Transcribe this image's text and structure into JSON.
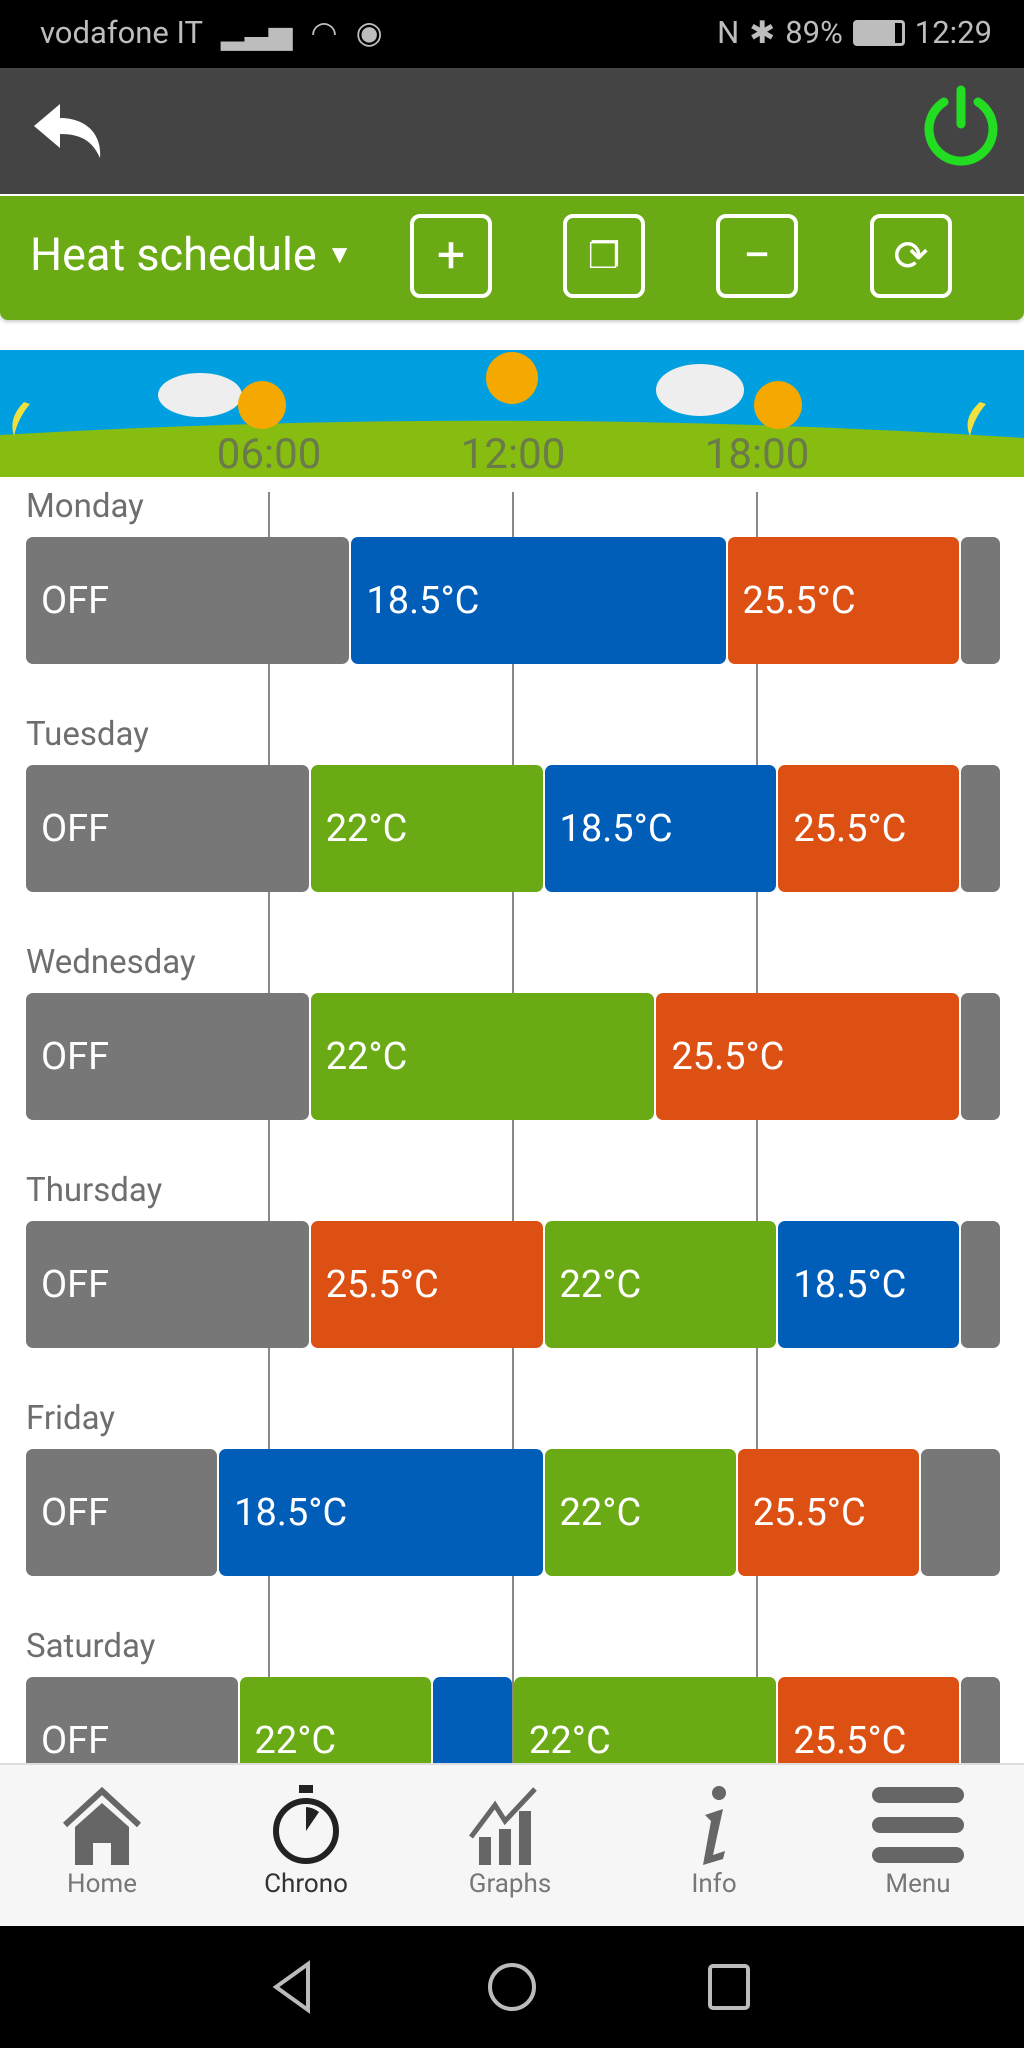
{
  "status_bar": {
    "carrier": "vodafone IT",
    "battery": "89%",
    "time": "12:29"
  },
  "toolbar": {
    "title": "Heat schedule",
    "buttons": [
      "add",
      "copy",
      "remove",
      "sync"
    ]
  },
  "timeline": {
    "ticks": [
      "06:00",
      "12:00",
      "18:00"
    ],
    "tick_hours": [
      6,
      12,
      18
    ]
  },
  "colors": {
    "off": "#777777",
    "18.5°C": "#005eb8",
    "22°C": "#6aaa15",
    "25.5°C": "#dd5014",
    "header": "#444444",
    "toolbar": "#6aaa14",
    "power": "#22dd22"
  },
  "schedule": [
    {
      "day": "Monday",
      "segments": [
        {
          "label": "OFF",
          "start": 0,
          "end": 8
        },
        {
          "label": "18.5°C",
          "start": 8,
          "end": 17.25
        },
        {
          "label": "25.5°C",
          "start": 17.25,
          "end": 23
        },
        {
          "label": "",
          "start": 23,
          "end": 24
        }
      ]
    },
    {
      "day": "Tuesday",
      "segments": [
        {
          "label": "OFF",
          "start": 0,
          "end": 7
        },
        {
          "label": "22°C",
          "start": 7,
          "end": 12.75
        },
        {
          "label": "18.5°C",
          "start": 12.75,
          "end": 18.5
        },
        {
          "label": "25.5°C",
          "start": 18.5,
          "end": 23
        },
        {
          "label": "",
          "start": 23,
          "end": 24
        }
      ]
    },
    {
      "day": "Wednesday",
      "segments": [
        {
          "label": "OFF",
          "start": 0,
          "end": 7
        },
        {
          "label": "22°C",
          "start": 7,
          "end": 15.5
        },
        {
          "label": "25.5°C",
          "start": 15.5,
          "end": 23
        },
        {
          "label": "",
          "start": 23,
          "end": 24
        }
      ]
    },
    {
      "day": "Thursday",
      "segments": [
        {
          "label": "OFF",
          "start": 0,
          "end": 7
        },
        {
          "label": "25.5°C",
          "start": 7,
          "end": 12.75
        },
        {
          "label": "22°C",
          "start": 12.75,
          "end": 18.5
        },
        {
          "label": "18.5°C",
          "start": 18.5,
          "end": 23
        },
        {
          "label": "",
          "start": 23,
          "end": 24
        }
      ]
    },
    {
      "day": "Friday",
      "segments": [
        {
          "label": "OFF",
          "start": 0,
          "end": 4.75
        },
        {
          "label": "18.5°C",
          "start": 4.75,
          "end": 12.75
        },
        {
          "label": "22°C",
          "start": 12.75,
          "end": 17.5
        },
        {
          "label": "25.5°C",
          "start": 17.5,
          "end": 22
        },
        {
          "label": "",
          "start": 22,
          "end": 24
        }
      ]
    },
    {
      "day": "Saturday",
      "segments": [
        {
          "label": "OFF",
          "start": 0,
          "end": 5.25
        },
        {
          "label": "22°C",
          "start": 5.25,
          "end": 10
        },
        {
          "label": "",
          "start": 10,
          "end": 12
        },
        {
          "label": "22°C",
          "start": 12,
          "end": 18.5
        },
        {
          "label": "25.5°C",
          "start": 18.5,
          "end": 23
        },
        {
          "label": "",
          "start": 23,
          "end": 24
        }
      ]
    }
  ],
  "segment_kinds": {
    "OFF": "off",
    "18.5°C": "blue",
    "22°C": "green",
    "25.5°C": "orange"
  },
  "bottom_nav": [
    {
      "label": "Home",
      "icon": "home-icon"
    },
    {
      "label": "Chrono",
      "icon": "stopwatch-icon",
      "active": true
    },
    {
      "label": "Graphs",
      "icon": "graph-icon"
    },
    {
      "label": "Info",
      "icon": "info-icon"
    },
    {
      "label": "Menu",
      "icon": "menu-icon"
    }
  ]
}
